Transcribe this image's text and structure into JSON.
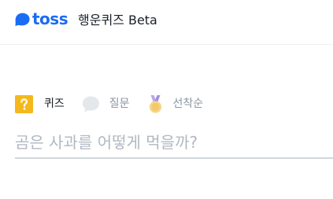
{
  "header": {
    "logo_text": "toss",
    "logo_icon": "toss-blob-icon",
    "service_title": "행운퀴즈 Beta"
  },
  "tabs": [
    {
      "label": "퀴즈",
      "icon": "question-box-icon",
      "active": true
    },
    {
      "label": "질문",
      "icon": "speech-bubble-icon",
      "active": false
    },
    {
      "label": "선착순",
      "icon": "medal-icon",
      "active": false
    }
  ],
  "answer": {
    "value": "",
    "placeholder": "곰은 사과를 어떻게 먹을까?"
  },
  "colors": {
    "brand": "#1a6cf5",
    "active_text": "#191f28",
    "inactive_text": "#8b95a1",
    "placeholder": "#b0b8c1",
    "quiz_icon": "#f5b81c",
    "medal_ribbon": "#b9a7ea",
    "medal": "#f6d58a"
  }
}
